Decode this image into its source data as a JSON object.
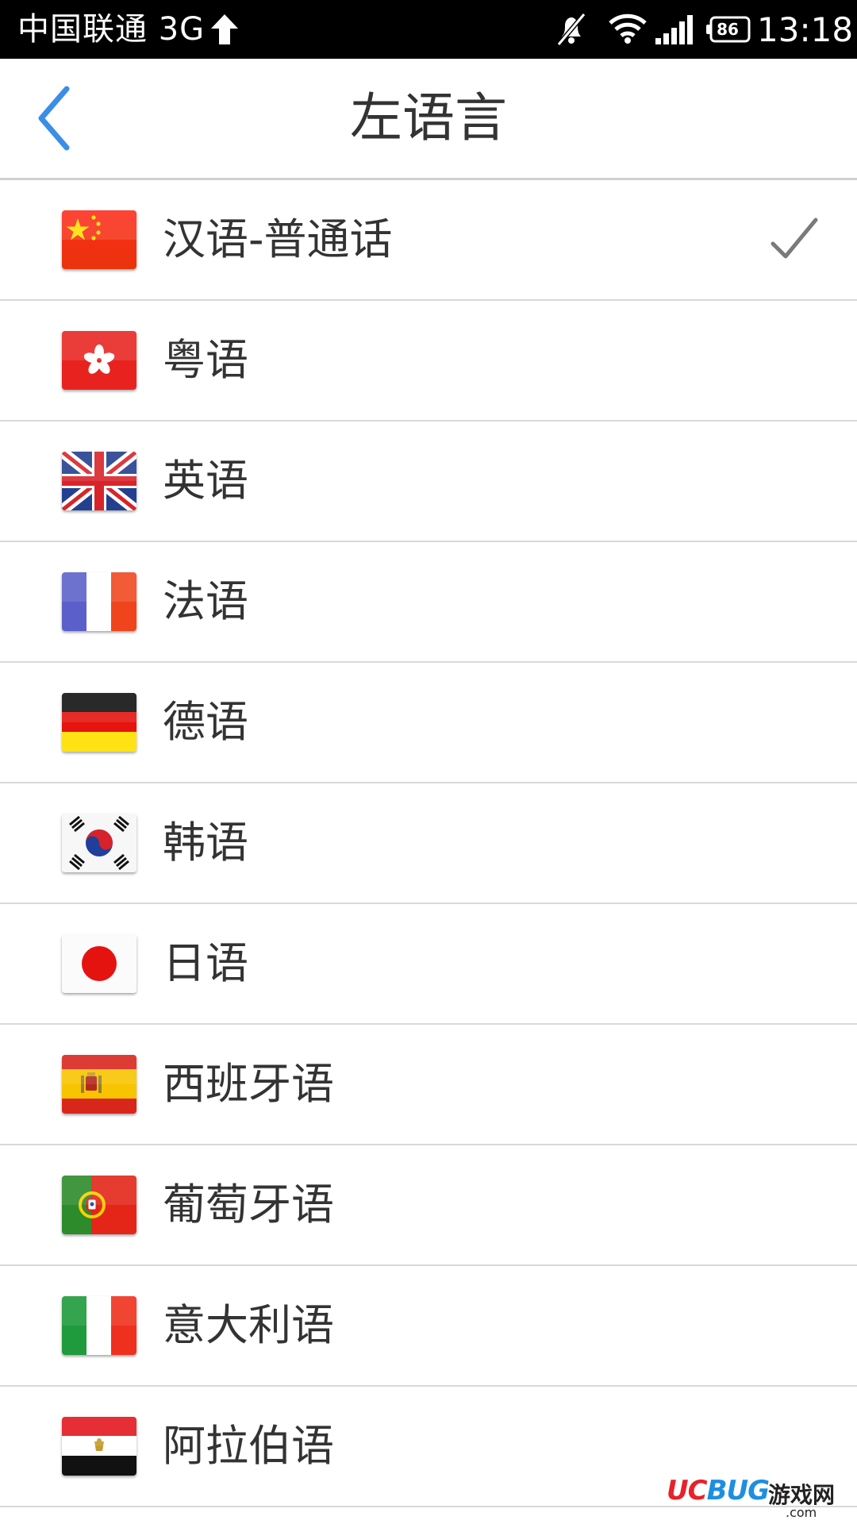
{
  "status_bar": {
    "carrier": "中国联通 3G",
    "battery": "86",
    "time": "13:18",
    "icons": [
      "upload-arrow-icon",
      "mute-icon",
      "wifi-icon",
      "signal-icon",
      "battery-icon"
    ]
  },
  "header": {
    "title": "左语言",
    "back_icon": "chevron-left-icon"
  },
  "colors": {
    "accent": "#3a8ee6",
    "text": "#333333",
    "divider": "#d9d9d9",
    "check": "#7a7a7a"
  },
  "languages": [
    {
      "label": "汉语-普通话",
      "flag": "china-flag-icon",
      "selected": true
    },
    {
      "label": "粤语",
      "flag": "hong-kong-flag-icon",
      "selected": false
    },
    {
      "label": "英语",
      "flag": "uk-flag-icon",
      "selected": false
    },
    {
      "label": "法语",
      "flag": "france-flag-icon",
      "selected": false
    },
    {
      "label": "德语",
      "flag": "germany-flag-icon",
      "selected": false
    },
    {
      "label": "韩语",
      "flag": "korea-flag-icon",
      "selected": false
    },
    {
      "label": "日语",
      "flag": "japan-flag-icon",
      "selected": false
    },
    {
      "label": "西班牙语",
      "flag": "spain-flag-icon",
      "selected": false
    },
    {
      "label": "葡萄牙语",
      "flag": "portugal-flag-icon",
      "selected": false
    },
    {
      "label": "意大利语",
      "flag": "italy-flag-icon",
      "selected": false
    },
    {
      "label": "阿拉伯语",
      "flag": "egypt-flag-icon",
      "selected": false
    }
  ],
  "watermark": {
    "logo_part1": "UC",
    "logo_part2": "BUG",
    "cn": "游戏网",
    "domain": ".com"
  }
}
